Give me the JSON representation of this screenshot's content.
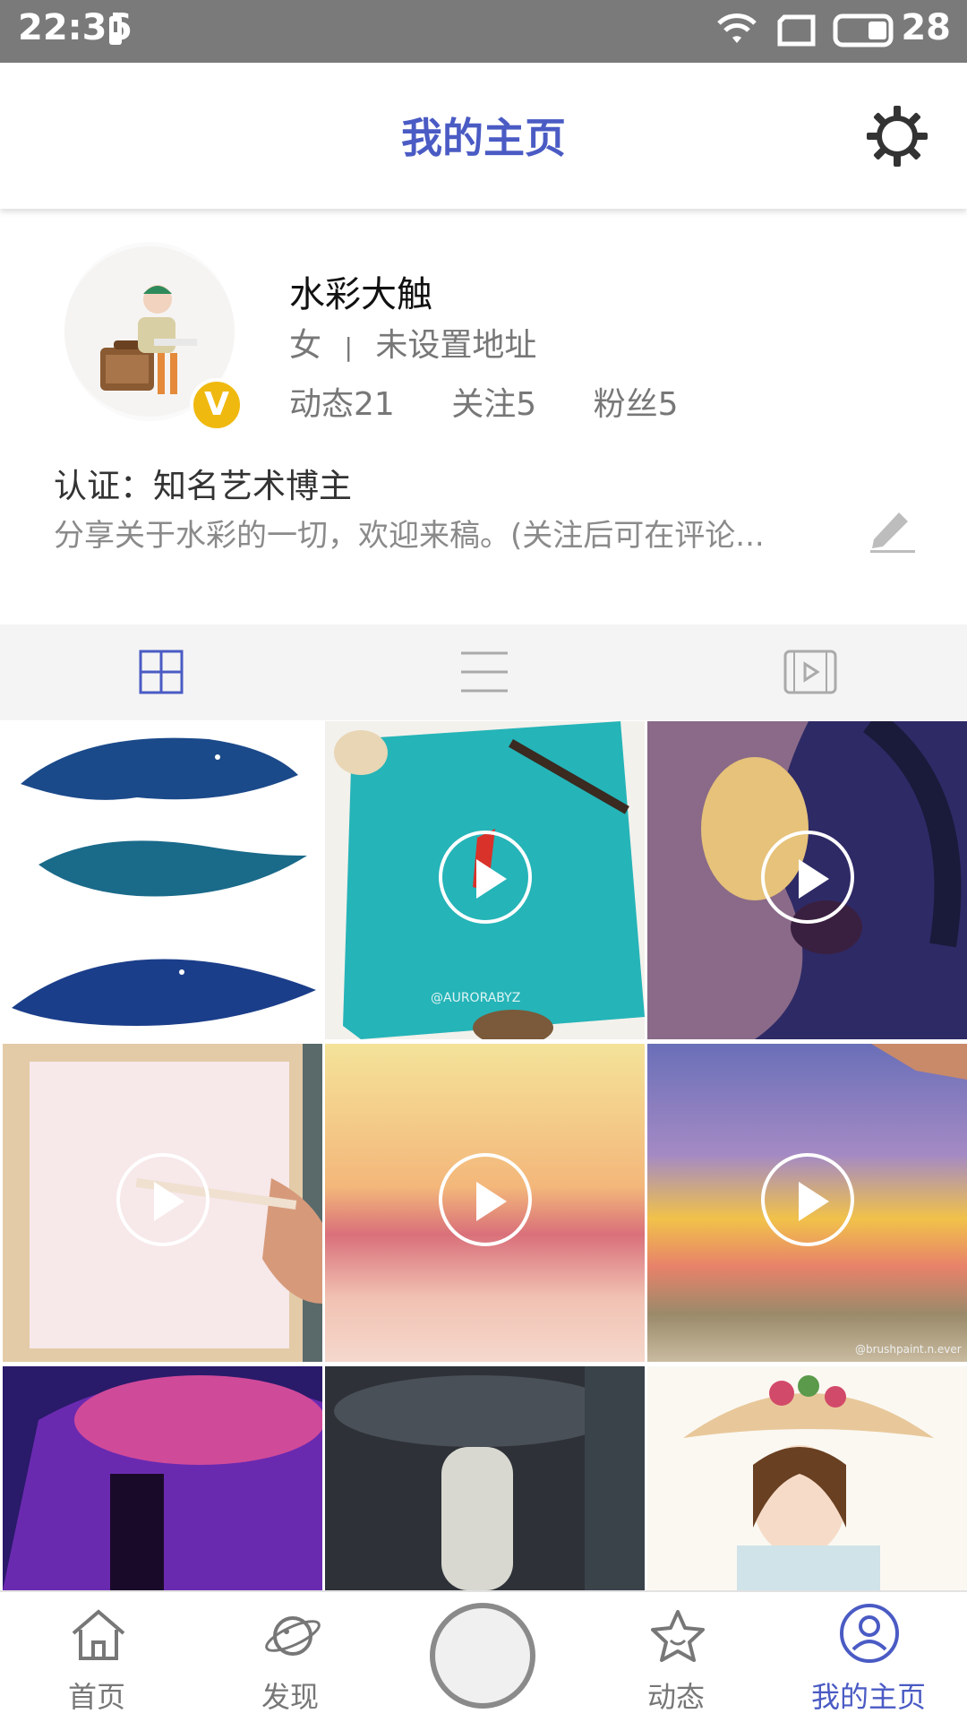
{
  "status_bar": {
    "time": "22:36",
    "battery": "28"
  },
  "header": {
    "title": "我的主页"
  },
  "profile": {
    "name": "水彩大触",
    "verified_mark": "V",
    "gender": "女",
    "separator": "|",
    "location": "未设置地址",
    "stats": {
      "posts": "动态21",
      "following": "关注5",
      "fans": "粉丝5"
    },
    "certification": "认证：知名艺术博主",
    "bio": "分享关于水彩的一切，欢迎来稿。(关注后可在评论..."
  },
  "view_tabs": [
    {
      "name": "grid-view",
      "active": true
    },
    {
      "name": "list-view",
      "active": false
    },
    {
      "name": "video-view",
      "active": false
    }
  ],
  "grid_watermarks": {
    "cell2": "@AURORABYZ",
    "cell6": "@brushpaint.n.ever"
  },
  "bottom_nav": {
    "home": "首页",
    "discover": "发现",
    "feed": "动态",
    "profile": "我的主页"
  },
  "colors": {
    "accent": "#4a5bc4",
    "badge": "#f0b90f",
    "status_bar": "#7a7a7a"
  }
}
